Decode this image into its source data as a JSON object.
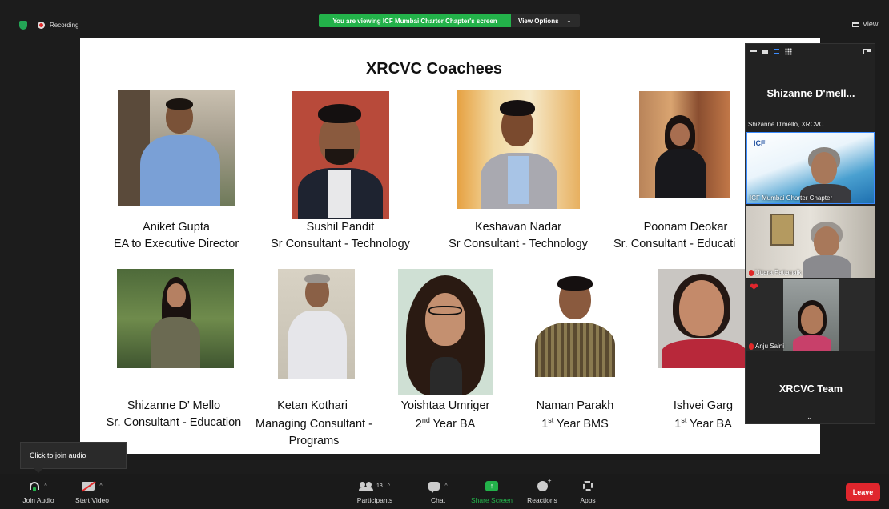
{
  "topbar": {
    "recording_label": "Recording",
    "share_banner": "You are viewing ICF Mumbai Charter Chapter's screen",
    "view_options": "View Options",
    "view_label": "View"
  },
  "slide": {
    "title": "XRCVC Coachees",
    "people": [
      {
        "name": "Aniket Gupta",
        "role": "EA to Executive Director"
      },
      {
        "name": "Sushil Pandit",
        "role": "Sr Consultant - Technology"
      },
      {
        "name": "Keshavan Nadar",
        "role": "Sr Consultant - Technology"
      },
      {
        "name": "Poonam Deokar",
        "role": "Sr. Consultant - Educati"
      },
      {
        "name": "Shizanne D’ Mello",
        "role": "Sr. Consultant - Education"
      },
      {
        "name": "Ketan Kothari",
        "role": "Managing Consultant - Programs"
      },
      {
        "name": "Yoishtaa Umriger",
        "role_num": "2",
        "role_sup": "nd",
        "role_rest": " Year BA"
      },
      {
        "name": "Naman Parakh",
        "role_num": "1",
        "role_sup": "st",
        "role_rest": " Year BMS"
      },
      {
        "name": "Ishvei Garg",
        "role_num": "1",
        "role_sup": "st",
        "role_rest": " Year BA"
      }
    ]
  },
  "panel": {
    "speaker_name": "Shizanne  D'mell...",
    "speaker_caption": "Shizanne D'mello, XRCVC",
    "tiles": [
      {
        "label": "ICF Mumbai Charter Chapter",
        "logo": "ICF"
      },
      {
        "label": "Uttara Pattanaik"
      },
      {
        "label": "Anju Saini"
      }
    ],
    "team_label": "XRCVC Team"
  },
  "tooltip": "Click to join audio",
  "toolbar": {
    "join_audio": "Join Audio",
    "start_video": "Start Video",
    "participants": "Participants",
    "participants_count": "13",
    "chat": "Chat",
    "share_screen": "Share Screen",
    "reactions": "Reactions",
    "apps": "Apps",
    "leave": "Leave"
  },
  "colors": {
    "share_green": "#23b24a",
    "leave_red": "#e0262d",
    "speaker_blue": "#3b8cff"
  }
}
